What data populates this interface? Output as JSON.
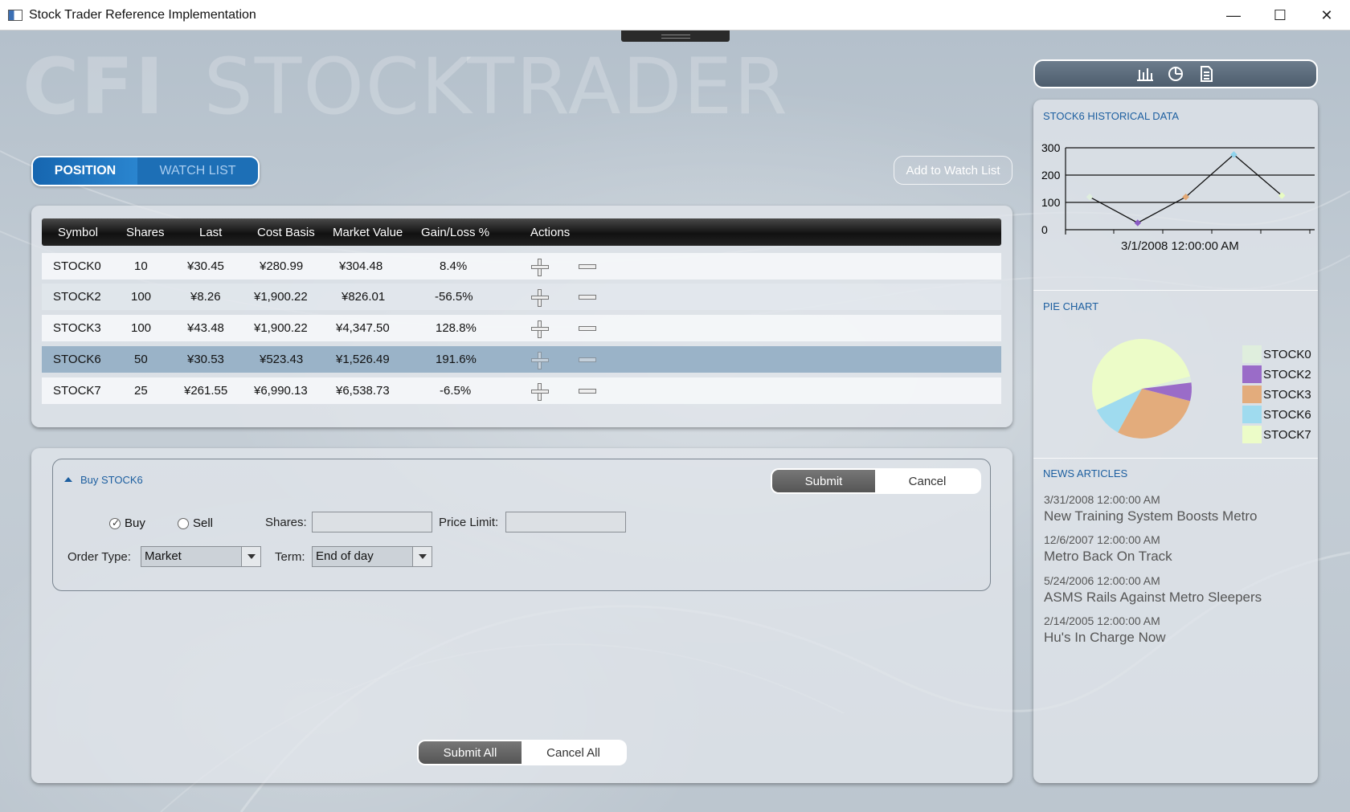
{
  "window": {
    "title": "Stock Trader Reference Implementation",
    "min": "—",
    "max": "☐",
    "close": "✕"
  },
  "brand": {
    "bold": "CFI",
    "name": "STOCKTRADER"
  },
  "tabs": {
    "position": "POSITION",
    "watchlist": "WATCH LIST"
  },
  "add_watch": "Add to Watch List",
  "positions": {
    "headers": [
      "Symbol",
      "Shares",
      "Last",
      "Cost Basis",
      "Market Value",
      "Gain/Loss %",
      "Actions"
    ],
    "rows": [
      {
        "symbol": "STOCK0",
        "shares": "10",
        "last": "¥30.45",
        "cost": "¥280.99",
        "market": "¥304.48",
        "gain": "8.4%"
      },
      {
        "symbol": "STOCK2",
        "shares": "100",
        "last": "¥8.26",
        "cost": "¥1,900.22",
        "market": "¥826.01",
        "gain": "-56.5%"
      },
      {
        "symbol": "STOCK3",
        "shares": "100",
        "last": "¥43.48",
        "cost": "¥1,900.22",
        "market": "¥4,347.50",
        "gain": "128.8%"
      },
      {
        "symbol": "STOCK6",
        "shares": "50",
        "last": "¥30.53",
        "cost": "¥523.43",
        "market": "¥1,526.49",
        "gain": "191.6%"
      },
      {
        "symbol": "STOCK7",
        "shares": "25",
        "last": "¥261.55",
        "cost": "¥6,990.13",
        "market": "¥6,538.73",
        "gain": "-6.5%"
      }
    ]
  },
  "order": {
    "title": "Buy STOCK6",
    "submit": "Submit",
    "cancel": "Cancel",
    "buy": "Buy",
    "sell": "Sell",
    "shares_label": "Shares:",
    "price_label": "Price Limit:",
    "shares_value": "",
    "price_value": "",
    "order_type_label": "Order Type:",
    "order_type": "Market",
    "term_label": "Term:",
    "term": "End of day",
    "submit_all": "Submit All",
    "cancel_all": "Cancel All"
  },
  "side": {
    "hist_title": "STOCK6 HISTORICAL DATA",
    "hist_date": "3/1/2008 12:00:00 AM",
    "pie_title": "PIE CHART",
    "news_title": "NEWS ARTICLES",
    "news": [
      {
        "date": "3/31/2008 12:00:00 AM",
        "title": "New Training System Boosts Metro"
      },
      {
        "date": "12/6/2007 12:00:00 AM",
        "title": "Metro Back On Track"
      },
      {
        "date": "5/24/2006 12:00:00 AM",
        "title": "ASMS Rails Against Metro Sleepers"
      },
      {
        "date": "2/14/2005 12:00:00 AM",
        "title": "Hu's In Charge Now"
      }
    ]
  },
  "chart_data": [
    {
      "type": "line",
      "title": "STOCK6 HISTORICAL DATA",
      "xlabel": "3/1/2008 12:00:00 AM",
      "yticks": [
        "0",
        "100",
        "200",
        "300"
      ],
      "ylim": [
        0,
        300
      ],
      "series": [
        {
          "values": [
            120,
            25,
            120,
            275,
            125
          ],
          "colors": [
            "#dfeedd",
            "#8a5cc4",
            "#e3a874",
            "#8fd3ec",
            "#e8fcc2"
          ]
        }
      ]
    },
    {
      "type": "pie",
      "title": "PIE CHART",
      "categories": [
        "STOCK0",
        "STOCK2",
        "STOCK3",
        "STOCK6",
        "STOCK7"
      ],
      "values": [
        2,
        6,
        29,
        10,
        53
      ],
      "colors": [
        "#dfeedd",
        "#9a6cc8",
        "#e3ac7c",
        "#9fdbef",
        "#ecfcc8"
      ]
    }
  ]
}
